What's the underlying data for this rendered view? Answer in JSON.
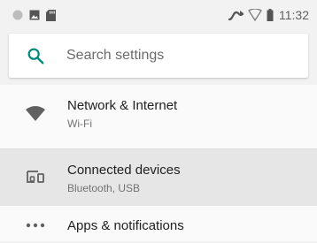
{
  "status_bar": {
    "time": "11:32",
    "left_icons": [
      "circle-icon",
      "image-icon",
      "sd-card-icon"
    ],
    "right_icons": [
      "data-transfer-icon",
      "wifi-icon",
      "battery-icon"
    ]
  },
  "search": {
    "placeholder": "Search settings",
    "accent": "#00897b"
  },
  "settings": {
    "items": [
      {
        "title": "Network & Internet",
        "subtitle": "Wi-Fi",
        "icon": "wifi-icon"
      },
      {
        "title": "Connected devices",
        "subtitle": "Bluetooth, USB",
        "icon": "devices-icon"
      },
      {
        "title": "Apps & notifications",
        "icon": "apps-icon"
      }
    ]
  }
}
